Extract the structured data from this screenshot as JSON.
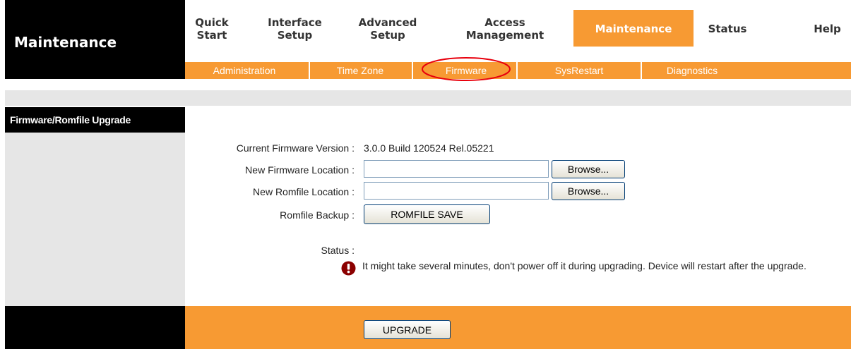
{
  "header": {
    "title": "Maintenance"
  },
  "main_nav": [
    {
      "label": "Quick\nStart"
    },
    {
      "label": "Interface\nSetup"
    },
    {
      "label": "Advanced\nSetup"
    },
    {
      "label": "Access\nManagement"
    },
    {
      "label": "Maintenance",
      "active": true
    },
    {
      "label": "Status"
    },
    {
      "label": "Help"
    }
  ],
  "sub_nav": [
    {
      "label": "Administration"
    },
    {
      "label": "Time Zone"
    },
    {
      "label": "Firmware",
      "highlighted": true
    },
    {
      "label": "SysRestart"
    },
    {
      "label": "Diagnostics"
    }
  ],
  "section": {
    "title": "Firmware/Romfile Upgrade"
  },
  "form": {
    "current_fw_label": "Current Firmware Version :",
    "current_fw_value": "3.0.0 Build 120524 Rel.05221",
    "new_fw_label": "New Firmware Location :",
    "new_fw_value": "",
    "new_rom_label": "New Romfile Location :",
    "new_rom_value": "",
    "browse_label": "Browse...",
    "rom_backup_label": "Romfile Backup :",
    "rom_save_label": "ROMFILE SAVE",
    "status_label": "Status :",
    "warning_text": "It might take several minutes, don't power off it during upgrading. Device will restart after the upgrade.",
    "upgrade_label": "UPGRADE"
  },
  "colors": {
    "accent": "#f79a33",
    "header_bg": "#000000",
    "sidebar_bg": "#e6e6e6",
    "highlight_ring": "#e8000d",
    "warning_icon": "#8b0000"
  },
  "icons": {
    "warning": "exclamation-circle-icon"
  }
}
